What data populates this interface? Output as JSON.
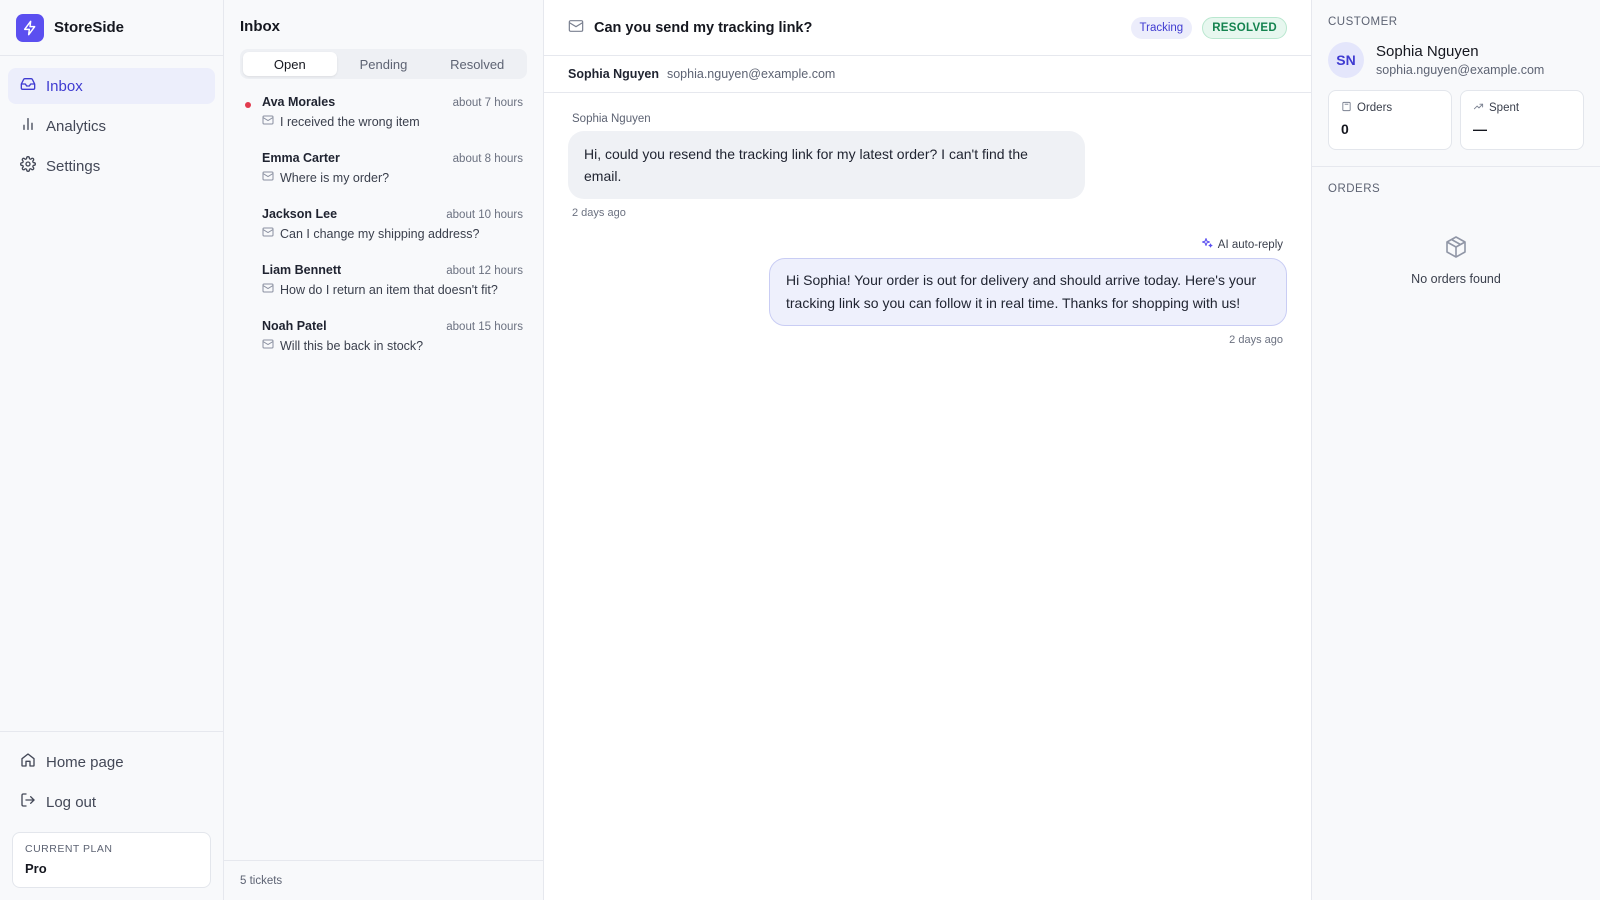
{
  "brand": {
    "name": "StoreSide",
    "accent": "#5b4ff0"
  },
  "nav": {
    "items": [
      {
        "label": "Inbox",
        "icon": "inbox-icon",
        "active": true
      },
      {
        "label": "Analytics",
        "icon": "bar-chart-icon",
        "active": false
      },
      {
        "label": "Settings",
        "icon": "gear-icon",
        "active": false
      }
    ],
    "bottom": [
      {
        "label": "Home page",
        "icon": "home-icon"
      },
      {
        "label": "Log out",
        "icon": "logout-icon"
      }
    ],
    "plan": {
      "label": "Current plan",
      "value": "Pro"
    }
  },
  "list": {
    "title": "Inbox",
    "tabs": [
      {
        "label": "Open",
        "active": true
      },
      {
        "label": "Pending",
        "active": false
      },
      {
        "label": "Resolved",
        "active": false
      }
    ],
    "tickets": [
      {
        "name": "Ava Morales",
        "time": "about 7 hours",
        "subject": "I received the wrong item",
        "unread": true
      },
      {
        "name": "Emma Carter",
        "time": "about 8 hours",
        "subject": "Where is my order?",
        "unread": false
      },
      {
        "name": "Jackson Lee",
        "time": "about 10 hours",
        "subject": "Can I change my shipping address?",
        "unread": false
      },
      {
        "name": "Liam Bennett",
        "time": "about 12 hours",
        "subject": "How do I return an item that doesn't fit?",
        "unread": false
      },
      {
        "name": "Noah Patel",
        "time": "about 15 hours",
        "subject": "Will this be back in stock?",
        "unread": false
      }
    ],
    "footer": "5 tickets"
  },
  "conversation": {
    "title": "Can you send my tracking link?",
    "tag": "Tracking",
    "status": "RESOLVED",
    "customer_name": "Sophia Nguyen",
    "customer_email": "sophia.nguyen@example.com",
    "incoming": {
      "author": "Sophia Nguyen",
      "text": "Hi, could you resend the tracking link for my latest order? I can't find the email.",
      "time": "2 days ago"
    },
    "outgoing": {
      "label": "AI auto-reply",
      "text": "Hi Sophia! Your order is out for delivery and should arrive today. Here's your tracking link so you can follow it in real time. Thanks for shopping with us!",
      "time": "2 days ago"
    }
  },
  "customer": {
    "section_label": "Customer",
    "initials": "SN",
    "name": "Sophia Nguyen",
    "email": "sophia.nguyen@example.com",
    "stats": [
      {
        "label": "Orders",
        "value": "0",
        "icon": "bag-icon"
      },
      {
        "label": "Spent",
        "value": "—",
        "icon": "trend-up-icon"
      }
    ],
    "orders_label": "Orders",
    "orders_empty": "No orders found"
  }
}
